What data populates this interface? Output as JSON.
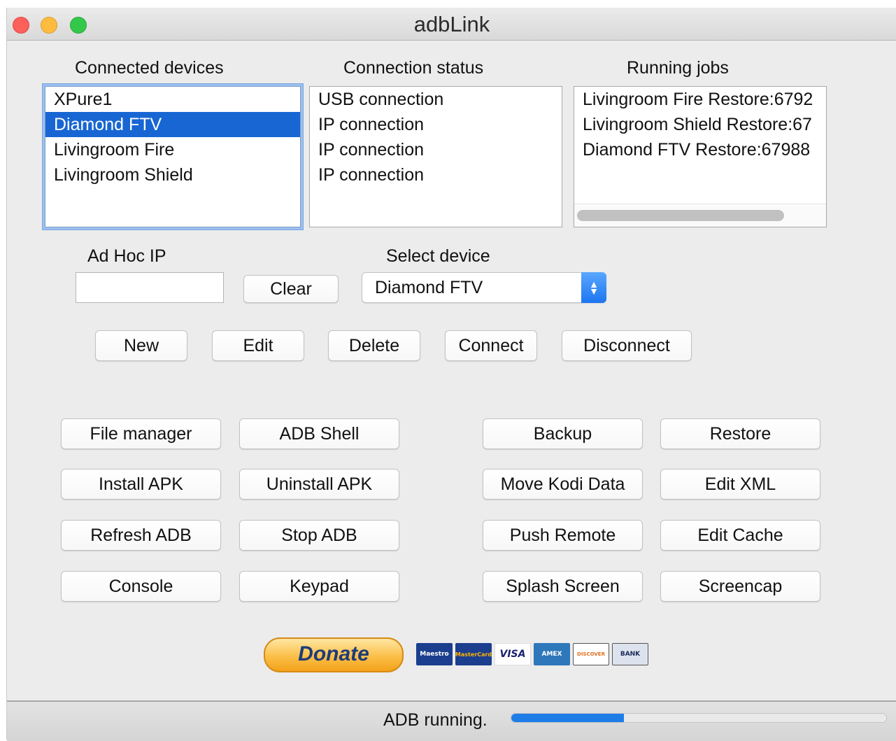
{
  "window": {
    "title": "adbLink"
  },
  "panels": {
    "connected_devices": {
      "label": "Connected devices",
      "items": [
        "XPure1",
        "Diamond FTV",
        "Livingroom Fire",
        "Livingroom Shield"
      ],
      "selected_index": 1
    },
    "connection_status": {
      "label": "Connection status",
      "items": [
        "USB connection",
        "IP connection",
        "IP connection",
        "IP connection"
      ]
    },
    "running_jobs": {
      "label": "Running jobs",
      "items": [
        "Livingroom Fire Restore:6792",
        "Livingroom Shield Restore:67",
        "Diamond FTV Restore:67988"
      ]
    }
  },
  "adhoc": {
    "label": "Ad Hoc IP",
    "value": "",
    "clear_label": "Clear"
  },
  "select_device": {
    "label": "Select device",
    "value": "Diamond FTV"
  },
  "device_buttons": {
    "new": "New",
    "edit": "Edit",
    "delete": "Delete",
    "connect": "Connect",
    "disconnect": "Disconnect"
  },
  "actions": {
    "file_manager": "File manager",
    "adb_shell": "ADB Shell",
    "backup": "Backup",
    "restore": "Restore",
    "install_apk": "Install APK",
    "uninstall_apk": "Uninstall APK",
    "move_kodi_data": "Move Kodi Data",
    "edit_xml": "Edit XML",
    "refresh_adb": "Refresh ADB",
    "stop_adb": "Stop ADB",
    "push_remote": "Push Remote",
    "edit_cache": "Edit Cache",
    "console": "Console",
    "keypad": "Keypad",
    "splash_screen": "Splash Screen",
    "screencap": "Screencap"
  },
  "donate": {
    "label": "Donate",
    "cards": [
      "Maestro",
      "MasterCard",
      "VISA",
      "AMEX",
      "DISCOVER",
      "BANK"
    ]
  },
  "status": {
    "text": "ADB running.",
    "progress": 0.3
  }
}
